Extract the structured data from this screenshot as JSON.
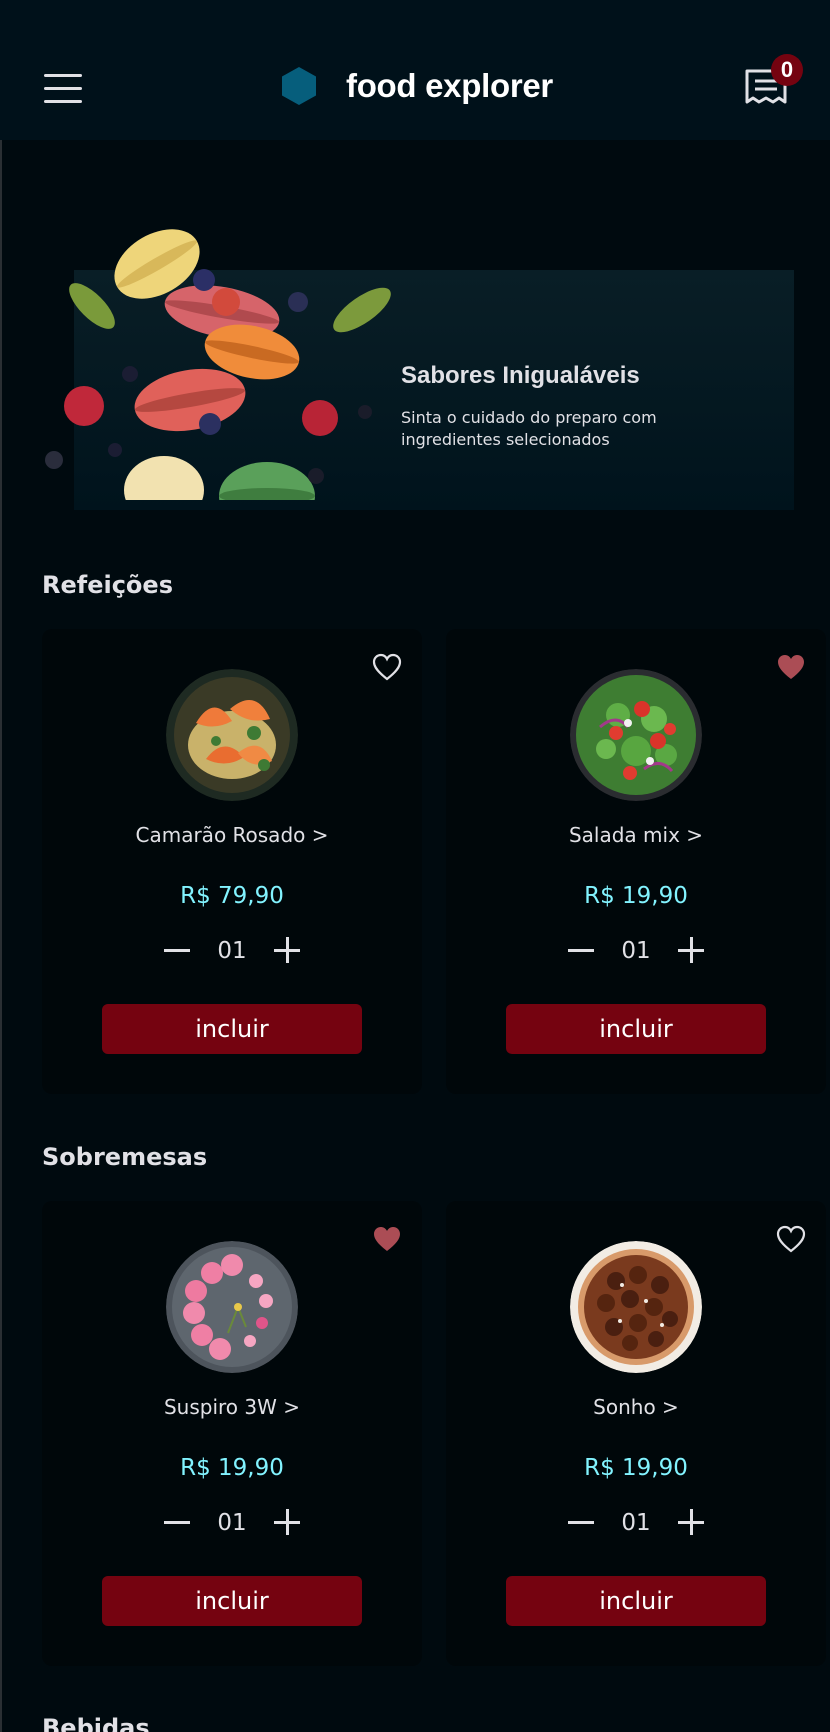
{
  "header": {
    "brand_name": "food explorer",
    "cart_count": "0"
  },
  "banner": {
    "title": "Sabores Inigualáveis",
    "subtitle": "Sinta o cuidado do preparo com ingredientes selecionados"
  },
  "sections": [
    {
      "title": "Refeições",
      "items": [
        {
          "name": "Camarão Rosado >",
          "price": "R$ 79,90",
          "qty": "01",
          "button": "incluir",
          "favorite": false,
          "dish_icon": "shrimp-pasta-image"
        },
        {
          "name": "Salada mix >",
          "price": "R$ 19,90",
          "qty": "01",
          "button": "incluir",
          "favorite": true,
          "dish_icon": "salad-image"
        }
      ]
    },
    {
      "title": "Sobremesas",
      "items": [
        {
          "name": "Suspiro 3W >",
          "price": "R$ 19,90",
          "qty": "01",
          "button": "incluir",
          "favorite": true,
          "dish_icon": "macarons-plate-image"
        },
        {
          "name": "Sonho >",
          "price": "R$ 19,90",
          "qty": "01",
          "button": "incluir",
          "favorite": false,
          "dish_icon": "tart-image"
        }
      ]
    },
    {
      "title": "Bebidas"
    }
  ],
  "colors": {
    "background": "#000a0f",
    "header": "#00111a",
    "card": "#00070a",
    "accent_button": "#750310",
    "price": "#82f3ff",
    "favorite_active": "#ab4d55"
  }
}
